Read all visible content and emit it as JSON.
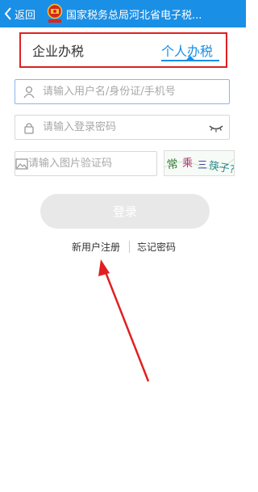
{
  "header": {
    "back_label": "返回",
    "title": "国家税务总局河北省电子税..."
  },
  "tabs": [
    {
      "label": "企业办税",
      "active": false
    },
    {
      "label": "个人办税",
      "active": true
    }
  ],
  "form": {
    "username_placeholder": "请输入用户名/身份证/手机号",
    "password_placeholder": "请输入登录密码",
    "captcha_placeholder": "请输入图片验证码",
    "captcha_text": "常 乘 三 筷子?"
  },
  "login_label": "登录",
  "links": {
    "register": "新用户注册",
    "forgot": "忘记密码"
  },
  "colors": {
    "accent": "#1a8fe6",
    "highlight_box": "#e02020",
    "annotation_arrow": "#e02020"
  }
}
